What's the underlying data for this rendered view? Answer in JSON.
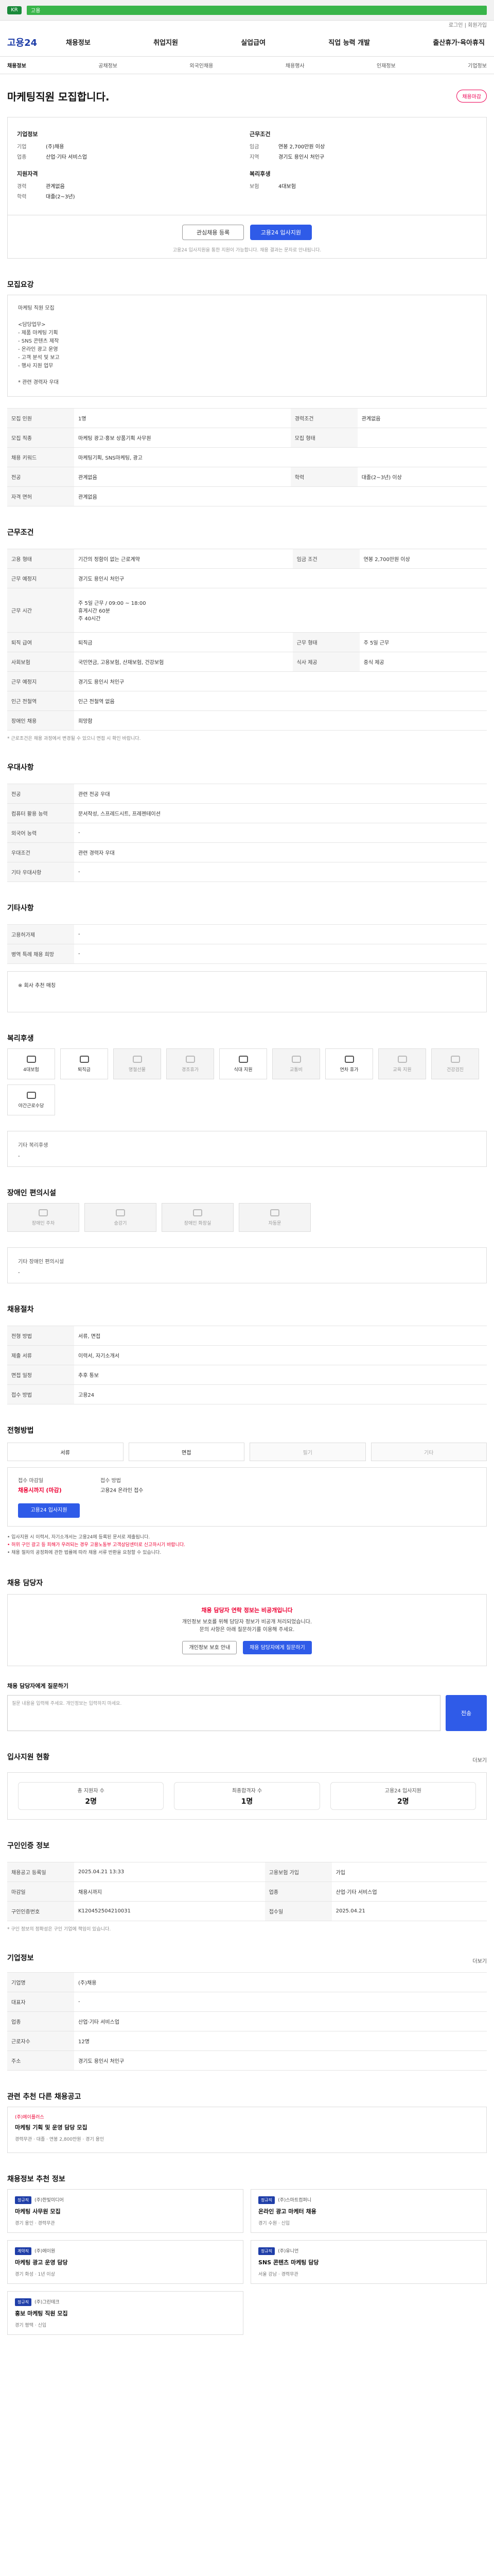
{
  "topbar": {
    "flag_label": "KR",
    "notice_bar": "고용"
  },
  "util": {
    "text": "로그인 | 회원가입"
  },
  "gnb": {
    "logo": "고용24",
    "items": [
      "채용정보",
      "취업지원",
      "실업급여",
      "직업 능력 개발",
      "출산휴가·육아휴직"
    ]
  },
  "subnav": [
    "채용정보",
    "공채정보",
    "외국인채용",
    "채용행사",
    "인재정보",
    "기업정보"
  ],
  "title": {
    "text": "마케팅직원 모집합니다.",
    "badge": "채용마감"
  },
  "summary": {
    "company_h": "기업정보",
    "company": [
      {
        "k": "기업",
        "v": "(주)채용"
      },
      {
        "k": "업종",
        "v": "산업·기타 서비스업"
      }
    ],
    "qual_h": "지원자격",
    "qual": [
      {
        "k": "경력",
        "v": "관계없음"
      },
      {
        "k": "학력",
        "v": "대졸(2~3년)"
      }
    ],
    "cond_h": "근무조건",
    "cond": [
      {
        "k": "임금",
        "v": "연봉 2,700만원 이상"
      },
      {
        "k": "지역",
        "v": "경기도 용인시 처인구"
      }
    ],
    "benefit_h": "복리후생",
    "benefit": [
      {
        "k": "보험",
        "v": "4대보험"
      }
    ],
    "btn_interest": "관심채용 등록",
    "btn_apply": "고용24 입사지원",
    "note": "고용24 입사지원을 통한 지원이 가능합니다. 채용 결과는 문자로 안내됩니다."
  },
  "recruit": {
    "h": "모집요강",
    "desc": "마케팅 직원 모집\n\n<담당업무>\n- 제품 마케팅 기획\n- SNS 콘텐츠 제작\n- 온라인 광고 운영\n- 고객 분석 및 보고\n- 행사 지원 업무\n\n* 관련 경력자 우대",
    "rows": [
      [
        "모집 인원",
        "1명",
        "경력조건",
        "관계없음"
      ],
      [
        "모집 직종",
        "마케팅 광고·홍보 상품기획 사무원",
        "모집 형태",
        ""
      ],
      [
        "채용 키워드",
        "마케팅기획, SNS마케팅, 광고",
        "",
        ""
      ],
      [
        "전공",
        "관계없음",
        "학력",
        "대졸(2~3년) 이상"
      ],
      [
        "자격 면허",
        "관계없음",
        "",
        ""
      ]
    ]
  },
  "work": {
    "h": "근무조건",
    "rows": [
      [
        "고용 형태",
        "기간의 정함이 없는 근로계약",
        "임금 조건",
        "연봉 2,700만원 이상"
      ],
      [
        "근무 예정지",
        "경기도 용인시 처인구",
        "",
        ""
      ],
      [
        "근무 시간",
        "주 5일 근무 / 09:00 ~ 18:00\n휴게시간 60분\n주 40시간",
        "",
        ""
      ],
      [
        "퇴직 급여",
        "퇴직금",
        "근무 형태",
        "주 5일 근무"
      ],
      [
        "사회보험",
        "국민연금, 고용보험, 산재보험, 건강보험",
        "식사 제공",
        "중식 제공"
      ],
      [
        "근무 예정지",
        "경기도 용인시 처인구",
        "",
        ""
      ],
      [
        "인근 전철역",
        "인근 전철역 없음",
        "",
        ""
      ],
      [
        "장애인 채용",
        "희망함",
        "",
        ""
      ]
    ],
    "note": "* 근로조건은 채용 과정에서 변경될 수 있으니 면접 시 확인 바랍니다."
  },
  "pref": {
    "h": "우대사항",
    "rows": [
      [
        "전공",
        "관련 전공 우대"
      ],
      [
        "컴퓨터 활용 능력",
        "문서작성, 스프레드시트, 프레젠테이션"
      ],
      [
        "외국어 능력",
        "-"
      ],
      [
        "우대조건",
        "관련 경력자 우대"
      ],
      [
        "기타 우대사항",
        "-"
      ]
    ]
  },
  "etc": {
    "h": "기타사항",
    "rows": [
      [
        "고용허가제",
        "-"
      ],
      [
        "병역 특례 채용 희망",
        "-"
      ]
    ],
    "box": "※ 회사 추천 매칭"
  },
  "welfare": {
    "h": "복리후생",
    "cats": [
      "4대보험",
      "퇴직금",
      "명절선물",
      "경조휴가",
      "식대 지원",
      "교통비",
      "연차 휴가",
      "교육 지원",
      "건강검진",
      "야간근로수당"
    ],
    "etc_h": "기타 복리후생",
    "etc_v": "-"
  },
  "conv": {
    "h": "장애인 편의시설",
    "items": [
      "장애인 주차",
      "승강기",
      "장애인 화장실",
      "자동문"
    ],
    "etc_h": "기타 장애인 편의시설",
    "etc_v": "-"
  },
  "hiring": {
    "h": "채용절차",
    "rows": [
      [
        "전형 방법",
        "서류, 면접",
        "",
        ""
      ],
      [
        "제출 서류",
        "이력서, 자기소개서",
        "",
        ""
      ],
      [
        "면접 일정",
        "추후 통보",
        "",
        ""
      ],
      [
        "접수 방법",
        "고용24",
        "",
        ""
      ]
    ]
  },
  "method": {
    "h": "전형방법",
    "items": [
      "서류",
      "면접",
      "필기",
      "기타"
    ]
  },
  "apply": {
    "lab1": "접수 마감일",
    "val1": "채용시까지 (마감)",
    "btn": "고용24 입사지원",
    "lab2": "접수 방법",
    "val2": "고용24 온라인 접수"
  },
  "notes": [
    "• 입사지원 시 이력서, 자기소개서는 고용24에 등록된 문서로 제출됩니다.",
    "• 허위 구인 광고 등 피해가 우려되는 경우 고용노동부 고객상담센터로 신고하시기 바랍니다.",
    "• 채용 절차의 공정화에 관한 법률에 따라 채용 서류 반환을 요청할 수 있습니다."
  ],
  "contact": {
    "h": "채용 담당자",
    "warn_title": "채용 담당자 연락 정보는 비공개입니다",
    "warn_text": "개인정보 보호를 위해 담당자 정보가 비공개 처리되었습니다.\n문의 사항은 아래 질문하기를 이용해 주세요.",
    "btn1": "개인정보 보호 안내",
    "btn2": "채용 담당자에게 질문하기"
  },
  "qna": {
    "h": "채용 담당자에게 질문하기",
    "placeholder": "질문 내용을 입력해 주세요. 개인정보는 입력하지 마세요.",
    "send": "전송"
  },
  "stats": {
    "h": "입사지원 현황",
    "more": "더보기",
    "items": [
      {
        "lab": "총 지원자 수",
        "val": "2명"
      },
      {
        "lab": "최종합격자 수",
        "val": "1명"
      },
      {
        "lab": "고용24 입사지원",
        "val": "2명"
      }
    ]
  },
  "posting": {
    "h": "구인인증 정보",
    "rows": [
      [
        "채용공고 등록일",
        "2025.04.21 13:33",
        "고용보험 가입",
        "가입"
      ],
      [
        "마감일",
        "채용시까지",
        "업종",
        "산업·기타 서비스업"
      ],
      [
        "구인인증번호",
        "K120452504210031",
        "접수일",
        "2025.04.21"
      ]
    ],
    "note": "* 구인 정보의 정확성은 구인 기업에 책임이 있습니다."
  },
  "company": {
    "h": "기업정보",
    "more": "더보기",
    "rows": [
      [
        "기업명",
        "(주)채용"
      ],
      [
        "대표자",
        "-"
      ],
      [
        "업종",
        "산업·기타 서비스업"
      ],
      [
        "근로자수",
        "12명"
      ],
      [
        "주소",
        "경기도 용인시 처인구"
      ]
    ]
  },
  "similar": {
    "h": "관련 추천 다른 채용공고",
    "title": "마케팅 기획 및 운영 담당 모집",
    "co": "(주)에이플러스",
    "meta": "경력무관 · 대졸 · 연봉 2,800만원 · 경기 용인"
  },
  "recs": {
    "h": "채용정보 추천 정보",
    "items": [
      {
        "tag": "정규직",
        "co": "(주)한빛미디어",
        "t": "마케팅 사무원 모집",
        "m": "경기 용인 · 경력무관"
      },
      {
        "tag": "정규직",
        "co": "(주)스마트컴퍼니",
        "t": "온라인 광고 마케터 채용",
        "m": "경기 수원 · 신입"
      },
      {
        "tag": "계약직",
        "co": "(주)에이원",
        "t": "마케팅 광고 운영 담당",
        "m": "경기 화성 · 1년 이상"
      },
      {
        "tag": "정규직",
        "co": "(주)유니언",
        "t": "SNS 콘텐츠 마케팅 담당",
        "m": "서울 강남 · 경력무관"
      },
      {
        "tag": "정규직",
        "co": "(주)그린테크",
        "t": "홍보 마케팅 직원 모집",
        "m": "경기 평택 · 신입"
      }
    ]
  }
}
